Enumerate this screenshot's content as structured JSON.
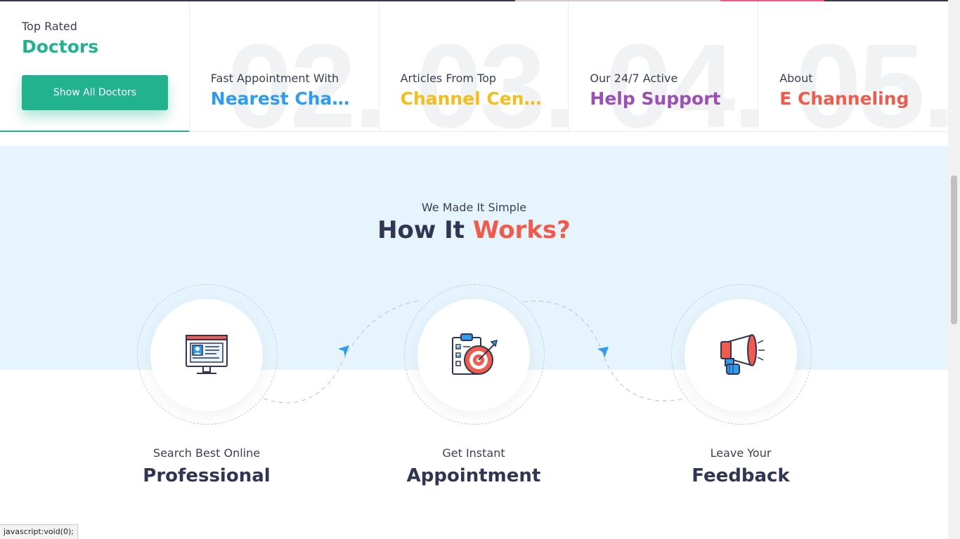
{
  "features": [
    {
      "number": "",
      "small": "Top Rated",
      "big": "Doctors",
      "color": "#20b38e",
      "button": "Show All Doctors"
    },
    {
      "number": "02.",
      "small": "Fast Appointment With",
      "big": "Nearest Chan...",
      "color": "#2f9cf0"
    },
    {
      "number": "03.",
      "small": "Articles From Top",
      "big": "Channel Cent...",
      "color": "#f4be1a"
    },
    {
      "number": "04.",
      "small": "Our 24/7 Active",
      "big": "Help Support",
      "color": "#9b4fb4"
    },
    {
      "number": "05.",
      "small": "About",
      "big": "E Channeling",
      "color": "#f25a4c"
    }
  ],
  "how": {
    "subtitle": "We Made It Simple",
    "title_main": "How It",
    "title_accent": "Works?"
  },
  "steps": [
    {
      "line1": "Search Best Online",
      "line2": "Professional",
      "icon": "computer-profile-icon"
    },
    {
      "line1": "Get Instant",
      "line2": "Appointment",
      "icon": "target-clipboard-icon"
    },
    {
      "line1": "Leave Your",
      "line2": "Feedback",
      "icon": "megaphone-icon"
    }
  ],
  "status_bar": "javascript:void(0);",
  "colors": {
    "green": "#20b38e",
    "blue": "#2f9cf0",
    "yellow": "#f4be1a",
    "purple": "#9b4fb4",
    "red": "#f25a4c",
    "light_bg": "#e6f4fd"
  }
}
